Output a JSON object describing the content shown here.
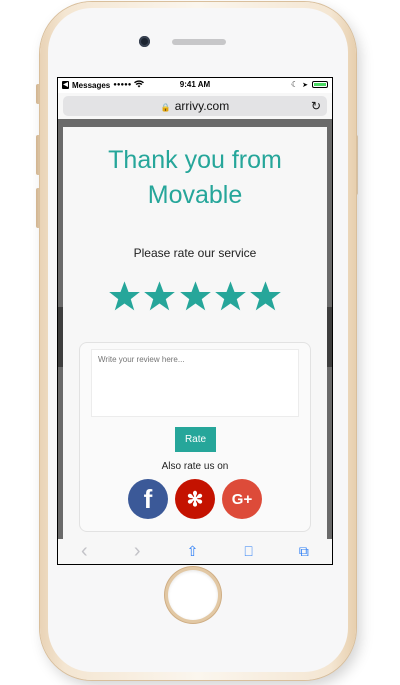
{
  "status_bar": {
    "carrier": "Messages",
    "signal": "●●●●●",
    "time": "9:41 AM",
    "moon": "☾",
    "location": "➤"
  },
  "browser": {
    "url": "arrivy.com",
    "lock": "🔒",
    "reload": "↻"
  },
  "modal": {
    "title_line1": "Thank you from",
    "title_line2": "Movable",
    "rate_label": "Please rate our service",
    "stars": 5,
    "review_placeholder": "Write your review here...",
    "rate_button": "Rate",
    "also_rate": "Also rate us on",
    "accent_color": "#26a69a",
    "social": [
      {
        "name": "facebook",
        "glyph": "f",
        "color": "#3b5998"
      },
      {
        "name": "yelp",
        "glyph": "✻",
        "color": "#c41200"
      },
      {
        "name": "google-plus",
        "glyph": "G+",
        "color": "#dd4b39"
      }
    ]
  },
  "toolbar": {
    "back": "‹",
    "forward": "›",
    "share": "⇧",
    "bookmarks": "⎕",
    "tabs": "⧉"
  }
}
